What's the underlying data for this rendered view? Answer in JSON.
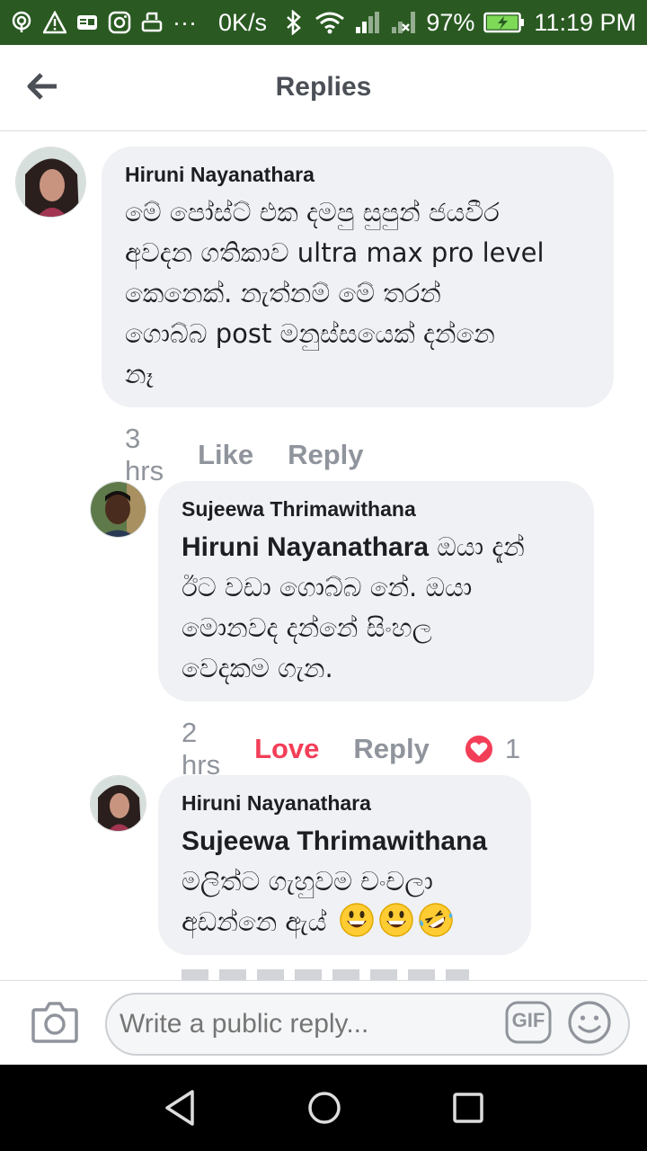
{
  "status_bar": {
    "speed": "0K/s",
    "battery": "97%",
    "time": "11:19 PM",
    "ellipsis": "···",
    "icons": [
      "hotspot-icon",
      "warning-icon",
      "id-card-icon",
      "instagram-icon",
      "printer-icon",
      "bluetooth-icon",
      "wifi-icon",
      "signal-icon",
      "signal-x-icon",
      "battery-charging-icon"
    ],
    "background": "#2a5a22"
  },
  "header": {
    "title": "Replies",
    "back_icon": "arrow-left-icon"
  },
  "comments": [
    {
      "author": "Hiruni Nayanathara",
      "lines": [
        "මේ පෝස්ට් එක දමපු සුපුන් ජයවීර",
        "අවදන ගතිකාව ultra max pro level",
        "කෙනෙක්. නැත්නම් මේ තරන්",
        "ගොබ්බ post මනුස්සයෙක් දන්නෙ",
        "නෑ"
      ],
      "time": "3 hrs",
      "like": "Like",
      "reply": "Reply"
    },
    {
      "author": "Sujeewa Thrimawithana",
      "mention": "Hiruni Nayanathara",
      "first_line_rest": " ඔයා දැන්",
      "lines": [
        "ඊට වඩා ගොබ්බ නේ. ඔයා",
        "මොනවද දන්නේ සිංහල",
        "වෙදකම ගැන."
      ],
      "time": "2 hrs",
      "like": "Love",
      "reply": "Reply",
      "reaction_count": "1",
      "reaction_icon": "heart-reaction-icon"
    },
    {
      "author": "Hiruni Nayanathara",
      "mention": "Sujeewa Thrimawithana",
      "lines": [
        "මලිත්ට ගැහුවම චංචලා",
        "අඩන්නෙ ඇය්"
      ],
      "emojis": [
        "grinning-face-icon",
        "grinning-face-icon",
        "rolling-laughing-face-icon"
      ]
    }
  ],
  "composer": {
    "placeholder": "Write a public reply...",
    "gif_label": "GIF"
  },
  "colors": {
    "love": "#f33e58",
    "bubble": "#f0f1f4",
    "muted": "#90949c"
  }
}
